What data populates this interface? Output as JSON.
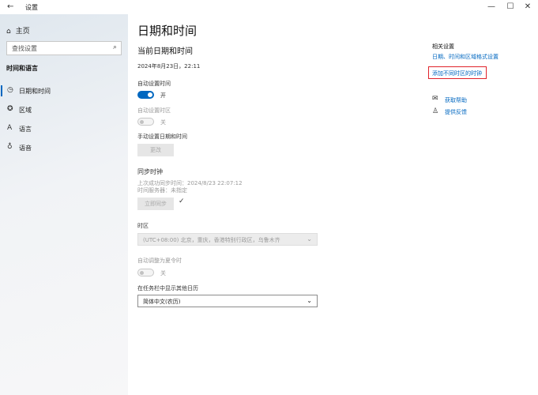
{
  "window": {
    "title": "设置",
    "back_glyph": "←",
    "min_glyph": "—",
    "max_glyph": "☐",
    "close_glyph": "✕"
  },
  "sidebar": {
    "home_label": "主页",
    "search_placeholder": "查找设置",
    "section_title": "时间和语言",
    "items": [
      {
        "label": "日期和时间",
        "icon": "clock-calendar-icon",
        "active": true
      },
      {
        "label": "区域",
        "icon": "region-icon",
        "active": false
      },
      {
        "label": "语言",
        "icon": "language-icon",
        "active": false
      },
      {
        "label": "语音",
        "icon": "microphone-icon",
        "active": false
      }
    ]
  },
  "main": {
    "page_title": "日期和时间",
    "current_heading": "当前日期和时间",
    "current_value": "2024年8月23日，22:11",
    "auto_time": {
      "label": "自动设置时间",
      "state": "开",
      "on": true
    },
    "auto_timezone": {
      "label": "自动设置时区",
      "state": "关",
      "on": false,
      "disabled": true
    },
    "manual": {
      "label": "手动设置日期和时间",
      "button": "更改"
    },
    "sync": {
      "heading": "同步时钟",
      "last_sync": "上次成功同步时间：2024/8/23 22:07:12",
      "server": "时间服务器：未指定",
      "button": "立即同步",
      "check": "✓"
    },
    "timezone": {
      "label": "时区",
      "value": "(UTC+08:00) 北京，重庆，香港特别行政区，乌鲁木齐"
    },
    "dst": {
      "label": "自动调整为夏令时",
      "state": "关",
      "on": false,
      "disabled": true
    },
    "calendar": {
      "label": "在任务栏中显示其他日历",
      "value": "简体中文(农历)"
    }
  },
  "related": {
    "title": "相关设置",
    "link_format": "日期、时间和区域格式设置",
    "link_clocks": "添加不同时区的时钟",
    "help": "获取帮助",
    "feedback": "提供反馈"
  },
  "colors": {
    "accent": "#0067c0",
    "highlight_box": "#e0232b"
  }
}
